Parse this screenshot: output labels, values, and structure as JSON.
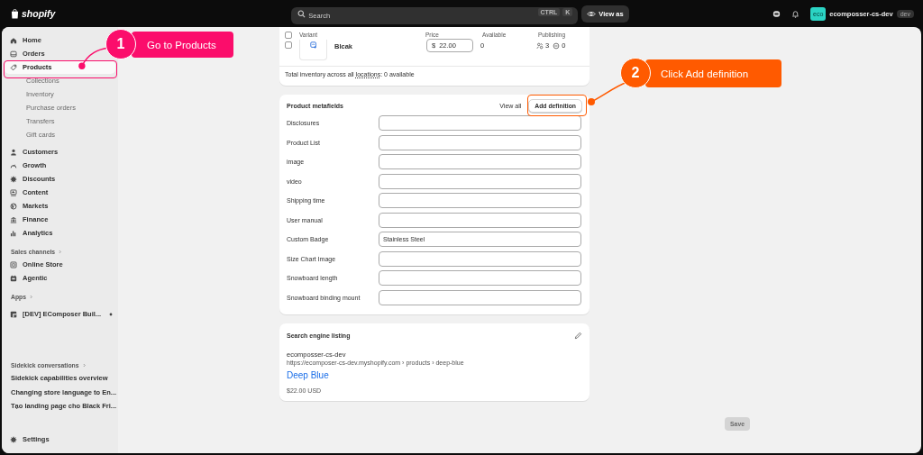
{
  "topbar": {
    "logo": "shopify",
    "search": {
      "placeholder": "Search",
      "keys": [
        "CTRL",
        "K"
      ]
    },
    "view_as": "View as",
    "store": {
      "avatar": "eco",
      "name": "ecomposser-cs-dev",
      "badge": "dev"
    }
  },
  "sidebar": {
    "nav": [
      {
        "label": "Home",
        "selected": false
      },
      {
        "label": "Orders",
        "selected": false
      },
      {
        "label": "Products",
        "selected": true,
        "children": [
          {
            "label": "Collections"
          },
          {
            "label": "Inventory"
          },
          {
            "label": "Purchase orders"
          },
          {
            "label": "Transfers"
          },
          {
            "label": "Gift cards"
          }
        ]
      },
      {
        "label": "Customers",
        "selected": false
      },
      {
        "label": "Growth",
        "selected": false
      },
      {
        "label": "Discounts",
        "selected": false
      },
      {
        "label": "Content",
        "selected": false
      },
      {
        "label": "Markets",
        "selected": false
      },
      {
        "label": "Finance",
        "selected": false
      },
      {
        "label": "Analytics",
        "selected": false
      }
    ],
    "sales_channels": {
      "label": "Sales channels",
      "items": [
        {
          "label": "Online Store"
        },
        {
          "label": "Agentic"
        }
      ]
    },
    "apps": {
      "label": "Apps",
      "items": [
        {
          "label": "[DEV] EComposer Buil..."
        }
      ]
    },
    "sidekick": {
      "label": "Sidekick conversations",
      "items": [
        {
          "label": "Sidekick capabilities overview"
        },
        {
          "label": "Changing store language to En..."
        },
        {
          "label": "Tạo landing page cho Black Fri..."
        }
      ]
    },
    "settings": "Settings"
  },
  "variants": {
    "columns": [
      "Variant",
      "Price",
      "Available",
      "Publishing"
    ],
    "all_checked": false,
    "rows": [
      {
        "checked": false,
        "name": "Blcak",
        "currency": "$",
        "price": "22.00",
        "available": "0",
        "published": "3",
        "unpublished": "0"
      }
    ],
    "total_prefix": "Total inventory across all",
    "total_link": "locations",
    "total_suffix": ": 0 available"
  },
  "metafields": {
    "title": "Product metafields",
    "view_all": "View all",
    "add_button": "Add definition",
    "fields": [
      {
        "label": "Disclosures"
      },
      {
        "label": "Product List"
      },
      {
        "label": "image"
      },
      {
        "label": "video"
      },
      {
        "label": "Shipping time"
      },
      {
        "label": "User manual"
      },
      {
        "label": "Custom Badge",
        "value": "Stainless Steel"
      },
      {
        "label": "Size Chart Image"
      },
      {
        "label": "Snowboard length"
      },
      {
        "label": "Snowboard binding mount"
      }
    ]
  },
  "seo": {
    "title": "Search engine listing",
    "site": "ecomposser-cs-dev",
    "url": "https://ecomposer-cs-dev.myshopify.com › products › deep-blue",
    "page_title": "Deep Blue",
    "price": "$22.00 USD"
  },
  "save": {
    "label": "Save",
    "disabled": true
  },
  "callouts": [
    {
      "number": "1",
      "text": "Go to Products",
      "color": "#fb0d6b"
    },
    {
      "number": "2",
      "text": "Click Add definition",
      "color": "#ff5a00"
    }
  ]
}
